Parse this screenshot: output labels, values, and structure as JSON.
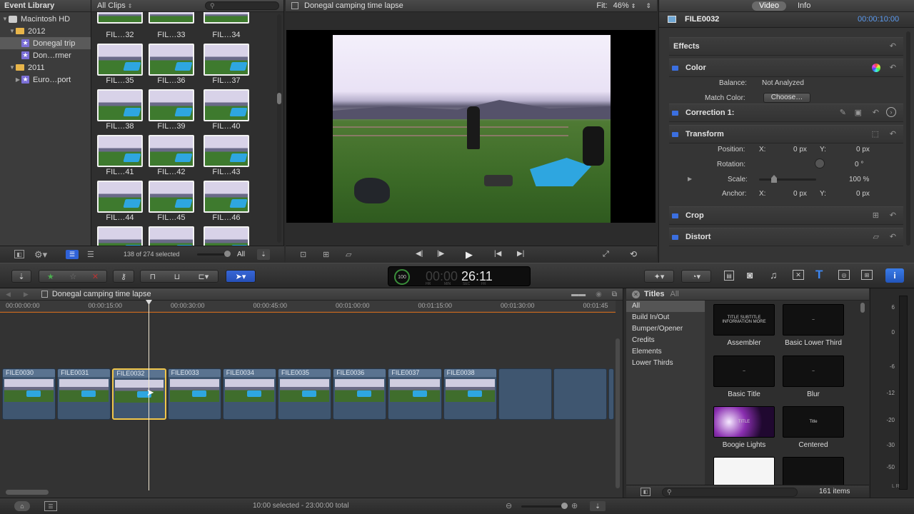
{
  "event_library": {
    "title": "Event Library",
    "items": [
      {
        "label": "Macintosh HD",
        "level": 0,
        "icon": "disk-icon"
      },
      {
        "label": "2012",
        "level": 1,
        "icon": "calendar-icon"
      },
      {
        "label": "Donegal trip",
        "level": 2,
        "icon": "star-event-icon",
        "selected": true
      },
      {
        "label": "Don…rmer",
        "level": 2,
        "icon": "star-event-icon"
      },
      {
        "label": "2011",
        "level": 1,
        "icon": "calendar-icon"
      },
      {
        "label": "Euro…port",
        "level": 2,
        "icon": "star-event-icon"
      }
    ]
  },
  "browser": {
    "filter_label": "All Clips",
    "clips": [
      "FIL…32",
      "FIL…33",
      "FIL…34",
      "FIL…35",
      "FIL…36",
      "FIL…37",
      "FIL…38",
      "FIL…39",
      "FIL…40",
      "FIL…41",
      "FIL…42",
      "FIL…43",
      "FIL…44",
      "FIL…45",
      "FIL…46"
    ],
    "selection_status": "138 of 274 selected",
    "show_label": "All"
  },
  "viewer": {
    "title": "Donegal camping time lapse",
    "fit_label": "Fit:",
    "zoom": "46%"
  },
  "inspector": {
    "tabs": [
      "Video",
      "Info"
    ],
    "clip_name": "FILE0032",
    "duration": "00:00:10:00",
    "effects_label": "Effects",
    "color": {
      "label": "Color",
      "balance_label": "Balance:",
      "balance_value": "Not Analyzed",
      "match_label": "Match Color:",
      "match_button": "Choose…"
    },
    "correction_label": "Correction 1:",
    "transform": {
      "label": "Transform",
      "position_label": "Position:",
      "x_label": "X:",
      "y_label": "Y:",
      "pos_x": "0 px",
      "pos_y": "0 px",
      "rotation_label": "Rotation:",
      "rotation_value": "0 °",
      "scale_label": "Scale:",
      "scale_value": "100 %",
      "anchor_label": "Anchor:",
      "anchor_x": "0 px",
      "anchor_y": "0 px"
    },
    "crop_label": "Crop",
    "distort_label": "Distort"
  },
  "toolbar": {
    "timecode": "26:11",
    "timecode_dim": "00:00",
    "timecode_units": [
      "HR",
      "MIN",
      "SEC",
      "FR"
    ],
    "timecode_percent": "100"
  },
  "timeline": {
    "project_title": "Donegal camping time lapse",
    "ruler": [
      "00:00:00:00",
      "00:00:15:00",
      "00:00:30:00",
      "00:00:45:00",
      "00:01:00:00",
      "00:01:15:00",
      "00:01:30:00",
      "00:01:45"
    ],
    "clips": [
      "FILE0030",
      "FILE0031",
      "FILE0032",
      "FILE0033",
      "FILE0034",
      "FILE0035",
      "FILE0036",
      "FILE0037",
      "FILE0038"
    ],
    "selected_clip": "FILE0032",
    "status": "10:00 selected - 23:00:00 total"
  },
  "titles_browser": {
    "title": "Titles",
    "all_label": "All",
    "categories": [
      "All",
      "Build In/Out",
      "Bumper/Opener",
      "Credits",
      "Elements",
      "Lower Thirds"
    ],
    "items": [
      "Assembler",
      "Basic Lower Third",
      "Basic Title",
      "Blur",
      "Boogie Lights",
      "Centered"
    ],
    "thumb_texts": {
      "assembler": "TITLE SUBTITLE INFORMATION MORE",
      "centered": "Title",
      "boogie": "TITLE"
    },
    "count": "161 items"
  },
  "meters": {
    "labels": [
      "6",
      "0",
      "-6",
      "-12",
      "-20",
      "-30",
      "-50"
    ],
    "channels": "L R"
  },
  "colors": {
    "accent_blue": "#3b6fe0",
    "selection_yellow": "#f0c64a",
    "clip_blue": "#3f5670"
  }
}
